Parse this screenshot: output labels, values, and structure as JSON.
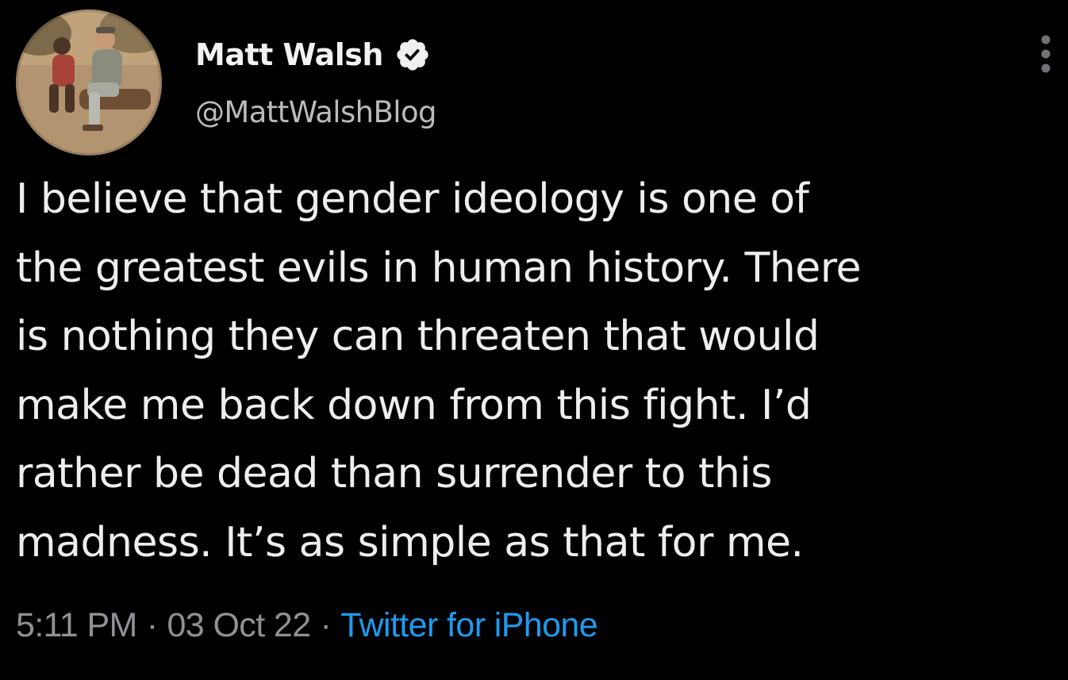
{
  "tweet": {
    "author": {
      "display_name": "Matt Walsh",
      "handle": "@MattWalshBlog",
      "verified_icon": "verified-badge-icon"
    },
    "more_icon": "more-options-icon",
    "text": "I believe that gender ideology is one of\nthe greatest evils in human history. There\nis nothing they can threaten that would\nmake me back down from this fight. I’d\nrather be dead than surrender to this\nmadness. It’s as simple as that for me.",
    "time": "5:11 PM",
    "date": "03 Oct 22",
    "separator": "·",
    "source": "Twitter for iPhone"
  },
  "colors": {
    "background": "#000000",
    "text": "#eeeeee",
    "secondary": "#8e9296",
    "link": "#1d9bf0"
  }
}
